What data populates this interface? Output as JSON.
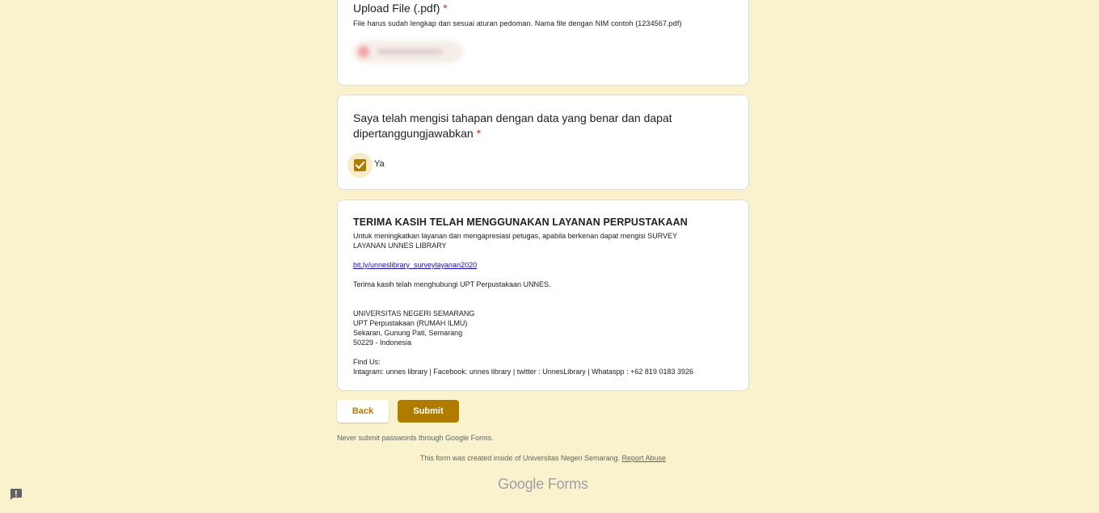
{
  "upload": {
    "title": "Upload File (.pdf)",
    "required_mark": "*",
    "help": "File harus sudah lengkap dan sesuai aturan pedoman. Nama file dengan NIM contoh (1234567.pdf)"
  },
  "confirm": {
    "title_line1": "Saya telah mengisi tahapan dengan data yang benar dan dapat",
    "title_line2": "dipertanggungjawabkan",
    "required_mark": "*",
    "option_label": "Ya",
    "checked": true
  },
  "info": {
    "title": "TERIMA KASIH TELAH MENGGUNAKAN LAYANAN PERPUSTAKAAN",
    "intro_line1": "Untuk meningkatkan layanan dan mengapresiasi petugas, apabila berkenan dapat mengisi SURVEY",
    "intro_line2": "LAYANAN UNNES LIBRARY",
    "link": "bit.ly/unneslibrary_surveylayanan2020",
    "thanks": "Terima kasih telah menghubungi UPT Perpustakaan UNNES.",
    "address": [
      "UNIVERSITAS NEGERI SEMARANG",
      "UPT Perpustakaan (RUMAH ILMU)",
      "Sekaran, Gunung Pati, Semarang",
      "50229 - Indonesia"
    ],
    "find_us": "Find Us:",
    "socials": "Intagram: unnes library | Facebook: unnes library | twitter : UnnesLibrary | Whataspp : +62 819 0183 3926"
  },
  "buttons": {
    "back": "Back",
    "submit": "Submit"
  },
  "footer": {
    "warning": "Never submit passwords through Google Forms.",
    "created": "This form was created inside of Universitas Negeri Semarang.",
    "report": "Report Abuse",
    "brand_google": "Google",
    "brand_forms": "Forms"
  },
  "colors": {
    "background": "#faf2cc",
    "accent": "#b07c00",
    "required": "#d93025"
  }
}
